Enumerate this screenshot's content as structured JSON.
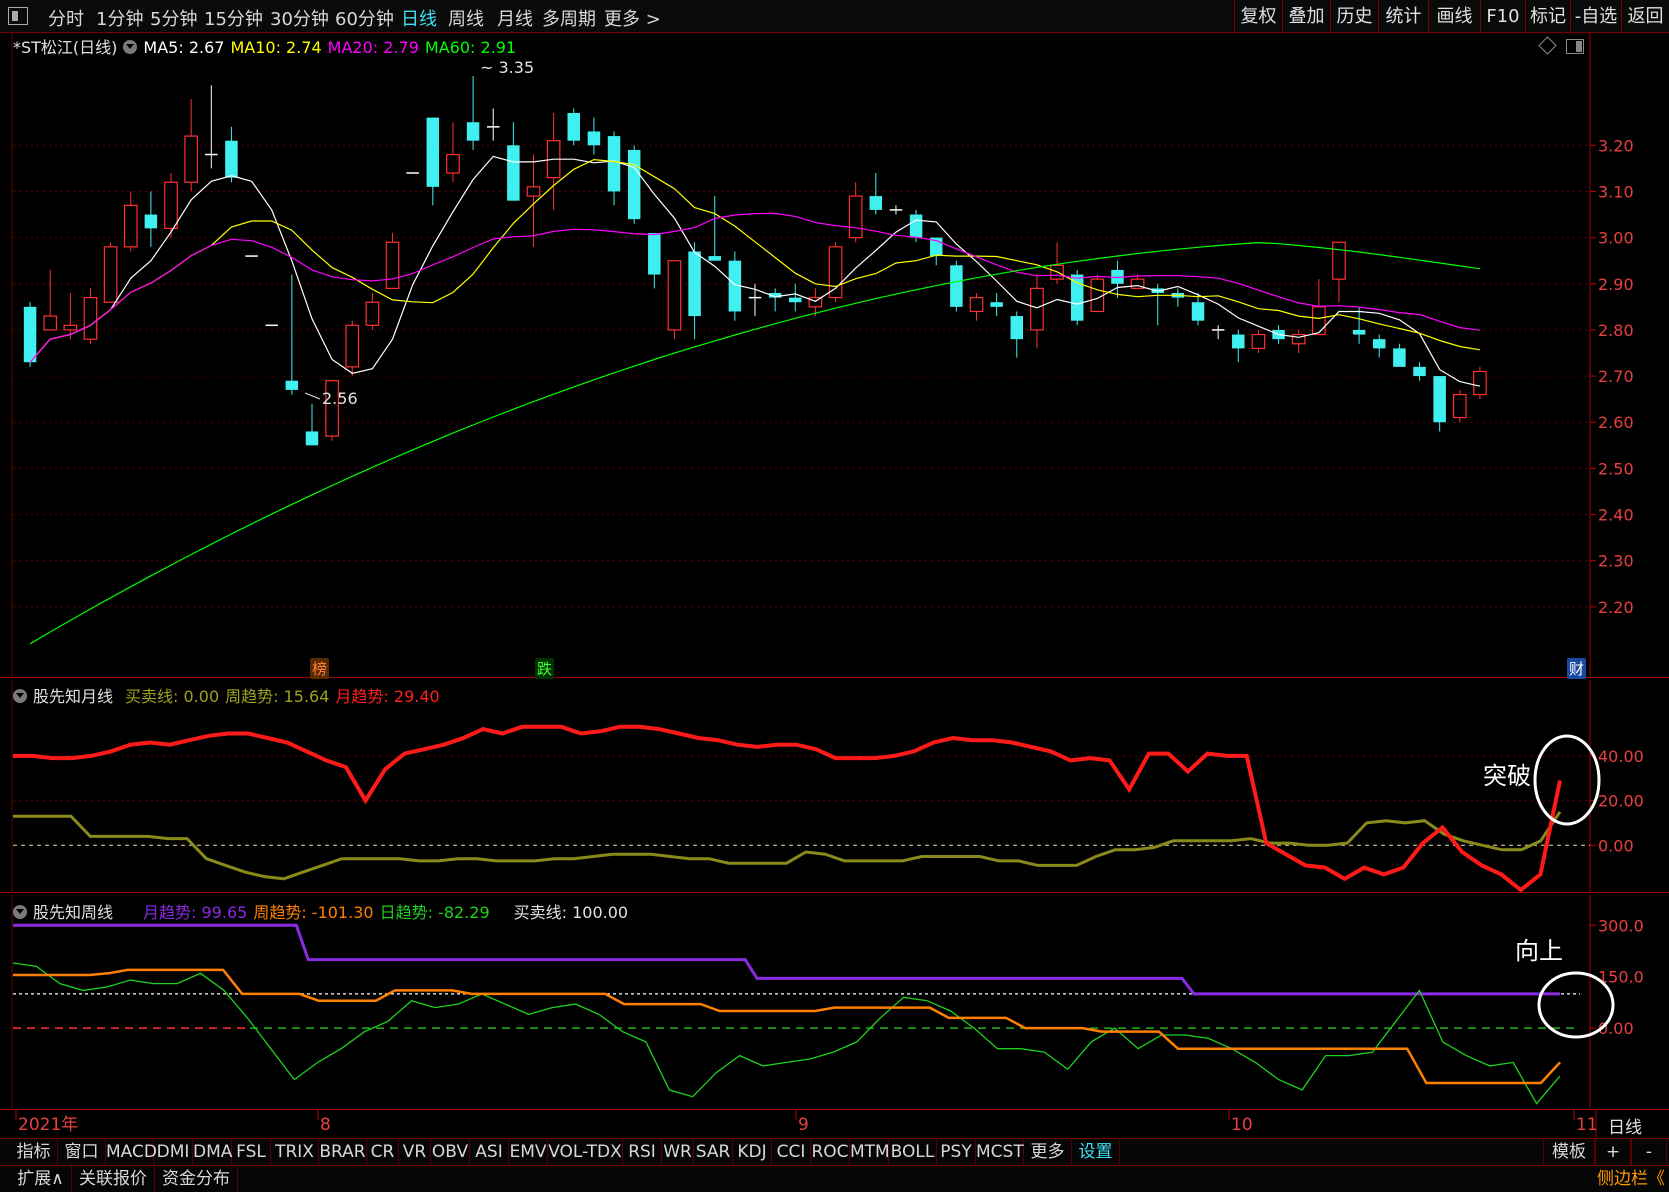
{
  "topbar": {
    "timeframes": [
      "分时",
      "1分钟",
      "5分钟",
      "15分钟",
      "30分钟",
      "60分钟",
      "日线",
      "周线",
      "月线",
      "多周期",
      "更多 >"
    ],
    "active_timeframe": "日线",
    "right_buttons": [
      "复权",
      "叠加",
      "历史",
      "统计",
      "画线",
      "F10",
      "标记",
      "-自选",
      "返回"
    ]
  },
  "main_panel": {
    "title": "*ST松江(日线)",
    "ma": [
      {
        "label": "MA5:",
        "value": "2.67",
        "color": "#ffffff"
      },
      {
        "label": "MA10:",
        "value": "2.74",
        "color": "#ffff00"
      },
      {
        "label": "MA20:",
        "value": "2.79",
        "color": "#ff00ff"
      },
      {
        "label": "MA60:",
        "value": "2.91",
        "color": "#00ff00"
      }
    ],
    "y_ticks": [
      "3.20",
      "3.10",
      "3.00",
      "2.90",
      "2.80",
      "2.70",
      "2.60",
      "2.50",
      "2.40",
      "2.30",
      "2.20"
    ],
    "high_label": "3.35",
    "low_label": "2.56",
    "markers": [
      {
        "text": "榜",
        "color": "#ff8040",
        "bg": "#5a2a00"
      },
      {
        "text": "跌",
        "color": "#40ff40",
        "bg": "#003300"
      },
      {
        "text": "财",
        "color": "#ffffff",
        "bg": "#1a4aa0"
      }
    ]
  },
  "monthly_panel": {
    "name": "股先知月线",
    "indicators": [
      {
        "label": "买卖线:",
        "value": "0.00",
        "color": "#a0a020"
      },
      {
        "label": "周趋势:",
        "value": "15.64",
        "color": "#a0a020"
      },
      {
        "label": "月趋势:",
        "value": "29.40",
        "color": "#ff2020"
      }
    ],
    "y_ticks": [
      "40.00",
      "20.00",
      "0.00"
    ],
    "annotation": "突破"
  },
  "weekly_panel": {
    "name": "股先知周线",
    "indicators": [
      {
        "label": "月趋势:",
        "value": "99.65",
        "color": "#8a2be2"
      },
      {
        "label": "周趋势:",
        "value": "-101.30",
        "color": "#ff8000"
      },
      {
        "label": "日趋势:",
        "value": "-82.29",
        "color": "#20d020"
      },
      {
        "label": "买卖线:",
        "value": "100.00",
        "color": "#e0e0e0"
      }
    ],
    "y_ticks": [
      "300.0",
      "150.0",
      "0.00"
    ],
    "annotation": "向上"
  },
  "x_axis": {
    "labels": [
      "2021年",
      "8",
      "9",
      "10",
      "11"
    ],
    "period": "日线"
  },
  "indicator_tabs": [
    "指标",
    "窗口",
    "MACD",
    "DMI",
    "DMA",
    "FSL",
    "TRIX",
    "BRAR",
    "CR",
    "VR",
    "OBV",
    "ASI",
    "EMV",
    "VOL-TDX",
    "RSI",
    "WR",
    "SAR",
    "KDJ",
    "CCI",
    "ROC",
    "MTM",
    "BOLL",
    "PSY",
    "MCST",
    "更多",
    "设置"
  ],
  "tab_right": [
    "模板",
    "+",
    "-"
  ],
  "status_bar": {
    "items": [
      "扩展∧",
      "关联报价",
      "资金分布"
    ],
    "sidebar": "侧边栏《"
  },
  "chart_data": [
    {
      "type": "candlestick",
      "title": "*ST松江(日线)",
      "ylim": [
        2.1,
        3.4
      ],
      "x_labels": [
        "2021年",
        "8",
        "9",
        "10",
        "11"
      ],
      "candles": [
        [
          2.85,
          2.73,
          2.86,
          2.72
        ],
        [
          2.8,
          2.83,
          2.93,
          2.8
        ],
        [
          2.8,
          2.81,
          2.88,
          2.78
        ],
        [
          2.78,
          2.87,
          2.89,
          2.77
        ],
        [
          2.86,
          2.98,
          2.99,
          2.86
        ],
        [
          2.98,
          3.07,
          3.1,
          2.97
        ],
        [
          3.05,
          3.02,
          3.1,
          2.98
        ],
        [
          3.02,
          3.12,
          3.14,
          3.0
        ],
        [
          3.12,
          3.22,
          3.3,
          3.1
        ],
        [
          3.18,
          3.18,
          3.33,
          3.15
        ],
        [
          3.21,
          3.13,
          3.24,
          3.12
        ],
        [
          2.96,
          2.96,
          2.96,
          2.96
        ],
        [
          2.81,
          2.81,
          2.81,
          2.81
        ],
        [
          2.69,
          2.67,
          2.92,
          2.66
        ],
        [
          2.58,
          2.55,
          2.64,
          2.55
        ],
        [
          2.57,
          2.69,
          2.69,
          2.56
        ],
        [
          2.72,
          2.81,
          2.82,
          2.7
        ],
        [
          2.81,
          2.86,
          2.88,
          2.8
        ],
        [
          2.89,
          2.99,
          3.01,
          2.89
        ],
        [
          3.14,
          3.14,
          3.14,
          3.14
        ],
        [
          3.26,
          3.11,
          3.26,
          3.07
        ],
        [
          3.14,
          3.18,
          3.25,
          3.12
        ],
        [
          3.25,
          3.21,
          3.35,
          3.19
        ],
        [
          3.24,
          3.24,
          3.28,
          3.21
        ],
        [
          3.2,
          3.08,
          3.25,
          3.08
        ],
        [
          3.09,
          3.11,
          3.18,
          2.98
        ],
        [
          3.13,
          3.21,
          3.27,
          3.06
        ],
        [
          3.27,
          3.21,
          3.28,
          3.2
        ],
        [
          3.23,
          3.2,
          3.26,
          3.18
        ],
        [
          3.22,
          3.1,
          3.23,
          3.07
        ],
        [
          3.19,
          3.04,
          3.2,
          3.03
        ],
        [
          3.01,
          2.92,
          3.01,
          2.89
        ],
        [
          2.8,
          2.95,
          2.95,
          2.78
        ],
        [
          2.97,
          2.83,
          2.99,
          2.78
        ],
        [
          2.96,
          2.95,
          3.09,
          2.95
        ],
        [
          2.95,
          2.84,
          2.97,
          2.82
        ],
        [
          2.87,
          2.87,
          2.9,
          2.83
        ],
        [
          2.88,
          2.87,
          2.89,
          2.84
        ],
        [
          2.87,
          2.86,
          2.9,
          2.84
        ],
        [
          2.85,
          2.87,
          2.89,
          2.83
        ],
        [
          2.87,
          2.98,
          2.99,
          2.86
        ],
        [
          3.0,
          3.09,
          3.12,
          2.99
        ],
        [
          3.09,
          3.06,
          3.14,
          3.05
        ],
        [
          3.06,
          3.06,
          3.07,
          3.05
        ],
        [
          3.05,
          3.0,
          3.06,
          2.99
        ],
        [
          3.0,
          2.96,
          3.0,
          2.94
        ],
        [
          2.94,
          2.85,
          2.95,
          2.84
        ],
        [
          2.84,
          2.87,
          2.88,
          2.82
        ],
        [
          2.86,
          2.85,
          2.88,
          2.83
        ],
        [
          2.83,
          2.78,
          2.84,
          2.74
        ],
        [
          2.8,
          2.89,
          2.92,
          2.76
        ],
        [
          2.91,
          2.94,
          2.99,
          2.9
        ],
        [
          2.92,
          2.82,
          2.93,
          2.81
        ],
        [
          2.84,
          2.91,
          2.92,
          2.84
        ],
        [
          2.93,
          2.9,
          2.95,
          2.87
        ],
        [
          2.89,
          2.91,
          2.92,
          2.89
        ],
        [
          2.89,
          2.88,
          2.9,
          2.81
        ],
        [
          2.88,
          2.87,
          2.89,
          2.85
        ],
        [
          2.86,
          2.82,
          2.88,
          2.81
        ],
        [
          2.8,
          2.8,
          2.81,
          2.78
        ],
        [
          2.79,
          2.76,
          2.8,
          2.73
        ],
        [
          2.76,
          2.79,
          2.8,
          2.75
        ],
        [
          2.8,
          2.78,
          2.81,
          2.77
        ],
        [
          2.77,
          2.79,
          2.8,
          2.75
        ],
        [
          2.79,
          2.85,
          2.91,
          2.79
        ],
        [
          2.91,
          2.99,
          2.99,
          2.86
        ],
        [
          2.8,
          2.79,
          2.85,
          2.77
        ],
        [
          2.78,
          2.76,
          2.79,
          2.74
        ],
        [
          2.76,
          2.72,
          2.77,
          2.72
        ],
        [
          2.72,
          2.7,
          2.73,
          2.69
        ],
        [
          2.7,
          2.6,
          2.7,
          2.58
        ],
        [
          2.61,
          2.66,
          2.67,
          2.6
        ],
        [
          2.66,
          2.71,
          2.72,
          2.65
        ]
      ]
    },
    {
      "type": "line",
      "title": "股先知月线",
      "ylim": [
        -20,
        65
      ],
      "series": [
        {
          "name": "月趋势",
          "values": [
            40,
            40,
            39,
            39,
            40,
            42,
            45,
            46,
            45,
            47,
            49,
            50,
            50,
            48,
            46,
            42,
            38,
            35,
            20,
            34,
            41,
            43,
            45,
            48,
            52,
            50,
            53,
            53,
            53,
            50,
            51,
            53,
            53,
            52,
            50,
            48,
            47,
            45,
            44,
            45,
            45,
            43,
            39,
            39,
            39,
            40,
            42,
            46,
            48,
            47,
            47,
            46,
            44,
            42,
            38,
            39,
            38,
            25,
            41,
            41,
            33,
            41,
            40,
            40,
            1,
            -4,
            -9,
            -10,
            -15,
            -10,
            -13,
            -10,
            1,
            8,
            -3,
            -9,
            -13,
            -20,
            -13,
            29
          ]
        },
        {
          "name": "周趋势",
          "values": [
            13,
            13,
            13,
            13,
            4,
            4,
            4,
            4,
            3,
            3,
            -6,
            -9,
            -12,
            -14,
            -15,
            -12,
            -9,
            -6,
            -6,
            -6,
            -6,
            -7,
            -7,
            -6,
            -6,
            -7,
            -7,
            -7,
            -6,
            -6,
            -5,
            -4,
            -4,
            -4,
            -5,
            -6,
            -6,
            -8,
            -8,
            -8,
            -8,
            -3,
            -4,
            -7,
            -7,
            -7,
            -7,
            -5,
            -5,
            -5,
            -5,
            -7,
            -7,
            -9,
            -9,
            -9,
            -5,
            -2,
            -2,
            -1,
            2,
            2,
            2,
            2,
            3,
            1,
            1,
            0,
            0,
            1,
            10,
            11,
            10,
            11,
            5,
            2,
            0,
            -2,
            -2,
            2,
            15
          ]
        }
      ]
    },
    {
      "type": "line",
      "title": "股先知周线",
      "ylim": [
        -230,
        330
      ],
      "series": [
        {
          "name": "月趋势",
          "values": [
            300,
            300,
            300,
            300,
            300,
            300,
            300,
            300,
            300,
            300,
            300,
            300,
            300,
            300,
            300,
            300,
            300,
            300,
            300,
            300,
            300,
            300,
            300,
            300,
            300,
            200,
            200,
            200,
            200,
            200,
            200,
            200,
            200,
            200,
            200,
            200,
            200,
            200,
            200,
            200,
            200,
            200,
            200,
            200,
            200,
            200,
            200,
            200,
            200,
            200,
            200,
            200,
            200,
            200,
            200,
            200,
            200,
            200,
            200,
            200,
            200,
            200,
            200,
            145,
            145,
            145,
            145,
            145,
            145,
            145,
            145,
            145,
            145,
            145,
            145,
            145,
            145,
            145,
            145,
            145,
            145,
            145,
            145,
            145,
            145,
            145,
            145,
            145,
            145,
            145,
            145,
            145,
            145,
            145,
            145,
            145,
            145,
            145,
            145,
            145,
            100,
            100,
            100,
            100,
            100,
            100,
            100,
            100,
            100,
            100,
            100,
            100,
            100,
            100,
            100,
            100,
            100,
            100,
            100,
            100,
            100,
            100,
            100,
            100,
            100,
            100,
            100,
            100,
            100,
            100,
            100,
            100
          ]
        },
        {
          "name": "周趋势",
          "values": [
            155,
            155,
            155,
            155,
            155,
            160,
            170,
            170,
            170,
            170,
            170,
            170,
            100,
            100,
            100,
            100,
            80,
            80,
            80,
            80,
            110,
            110,
            110,
            110,
            100,
            100,
            100,
            100,
            100,
            100,
            100,
            100,
            70,
            70,
            70,
            70,
            70,
            50,
            50,
            50,
            50,
            50,
            50,
            60,
            60,
            60,
            60,
            60,
            60,
            30,
            30,
            30,
            30,
            0,
            0,
            0,
            0,
            -10,
            -10,
            -10,
            -10,
            -60,
            -60,
            -60,
            -60,
            -60,
            -60,
            -60,
            -60,
            -60,
            -60,
            -60,
            -60,
            -60,
            -160,
            -160,
            -160,
            -160,
            -160,
            -160,
            -160,
            -100
          ]
        },
        {
          "name": "日趋势",
          "values": [
            190,
            180,
            130,
            110,
            120,
            140,
            130,
            130,
            160,
            110,
            30,
            -60,
            -150,
            -100,
            -60,
            -10,
            20,
            80,
            60,
            70,
            100,
            70,
            40,
            60,
            70,
            40,
            -10,
            -40,
            -180,
            -200,
            -130,
            -80,
            -110,
            -100,
            -90,
            -70,
            -40,
            30,
            90,
            80,
            50,
            0,
            -60,
            -60,
            -70,
            -120,
            -40,
            0,
            -60,
            -20,
            -20,
            -30,
            -60,
            -100,
            -150,
            -180,
            -80,
            -80,
            -70,
            20,
            110,
            -40,
            -80,
            -110,
            -100,
            -220,
            -140
          ]
        },
        {
          "name": "买卖线",
          "values": [
            100,
            100
          ]
        }
      ]
    }
  ]
}
